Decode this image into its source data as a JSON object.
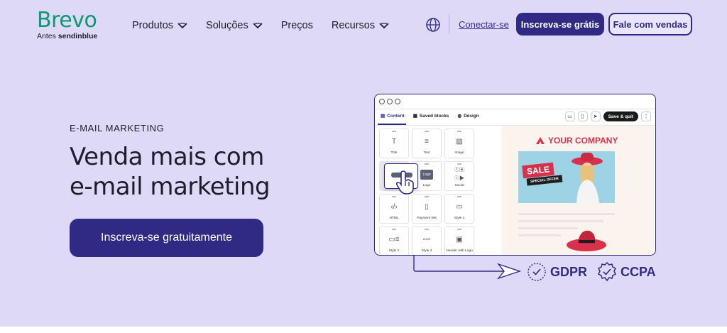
{
  "brand": {
    "name": "Brevo",
    "sub_prefix": "Antes",
    "sub_name": "sendinblue",
    "color": "#0b996e"
  },
  "nav": [
    {
      "label": "Produtos",
      "has_dropdown": true
    },
    {
      "label": "Soluções",
      "has_dropdown": true
    },
    {
      "label": "Preços",
      "has_dropdown": false
    },
    {
      "label": "Recursos",
      "has_dropdown": true
    }
  ],
  "header": {
    "language_icon": "globe-icon",
    "login_label": "Conectar-se",
    "signup_label": "Inscreva-se grátis",
    "sales_label": "Fale com vendas"
  },
  "hero": {
    "eyebrow": "E-MAIL MARKETING",
    "headline_line1": "Venda mais com",
    "headline_line2": "e-mail marketing",
    "cta_label": "Inscreva-se gratuitamente"
  },
  "editor": {
    "tabs": [
      {
        "label": "Content",
        "active": true
      },
      {
        "label": "Saved blocks",
        "active": false
      },
      {
        "label": "Design",
        "active": false
      }
    ],
    "save_label": "Save & quit",
    "blocks": [
      "Title",
      "Text",
      "Image",
      "",
      "Logo",
      "Social",
      "HTML",
      "Payment link",
      "Style 1",
      "Style 2",
      "Style 3",
      "Header with Logo"
    ],
    "drag_block_label": "Logo",
    "preview": {
      "company": "YOUR COMPANY",
      "sale_label": "SALE",
      "offer_label": "SPECIAL OFFER"
    }
  },
  "compliance": [
    {
      "label": "GDPR",
      "icon": "gdpr-shield-icon"
    },
    {
      "label": "CCPA",
      "icon": "ccpa-seal-icon"
    }
  ],
  "colors": {
    "background": "#ddd9f7",
    "primary": "#312a84",
    "accent": "#d9314b"
  }
}
